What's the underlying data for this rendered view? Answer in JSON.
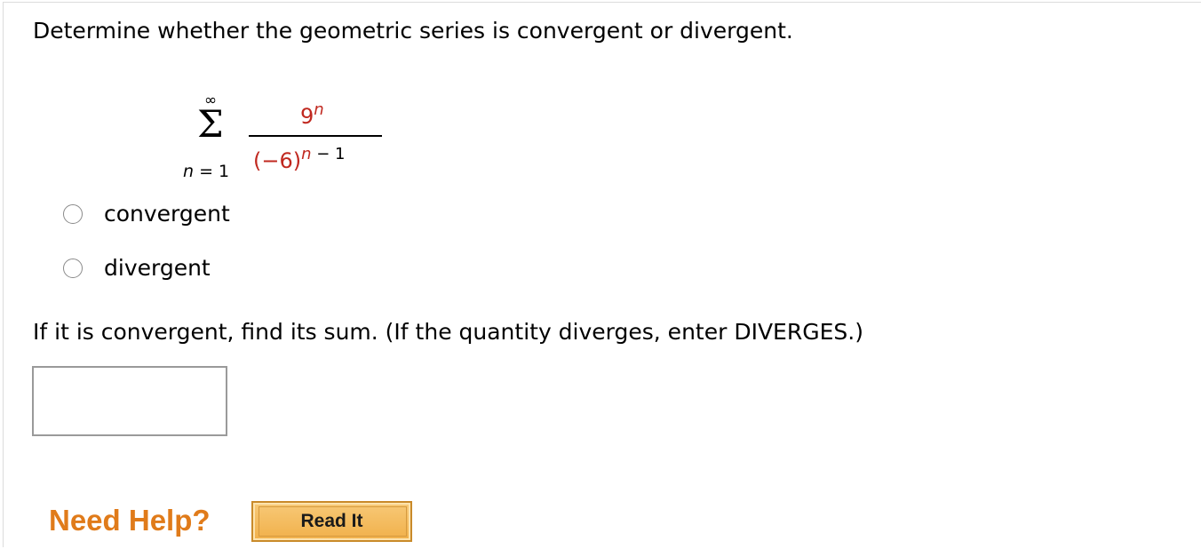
{
  "question": "Determine whether the geometric series is convergent or divergent.",
  "series": {
    "upper_limit": "∞",
    "sigma": "Σ",
    "index_var": "n",
    "lower_rest": " = 1",
    "numerator_base": "9",
    "numerator_exp": "n",
    "denominator_base": "(−6)",
    "denominator_exp_var": "n",
    "denominator_exp_rest": " − 1"
  },
  "options": [
    {
      "label": "convergent"
    },
    {
      "label": "divergent"
    }
  ],
  "prompt": "If it is convergent, find its sum. (If the quantity diverges, enter DIVERGES.)",
  "answer": {
    "value": "",
    "placeholder": ""
  },
  "help": {
    "need_help_label": "Need Help?",
    "read_it_label": "Read It"
  },
  "colors": {
    "math_accent": "#c0281f",
    "help_orange": "#e07b1a",
    "button_fill": "#f1b04a"
  }
}
